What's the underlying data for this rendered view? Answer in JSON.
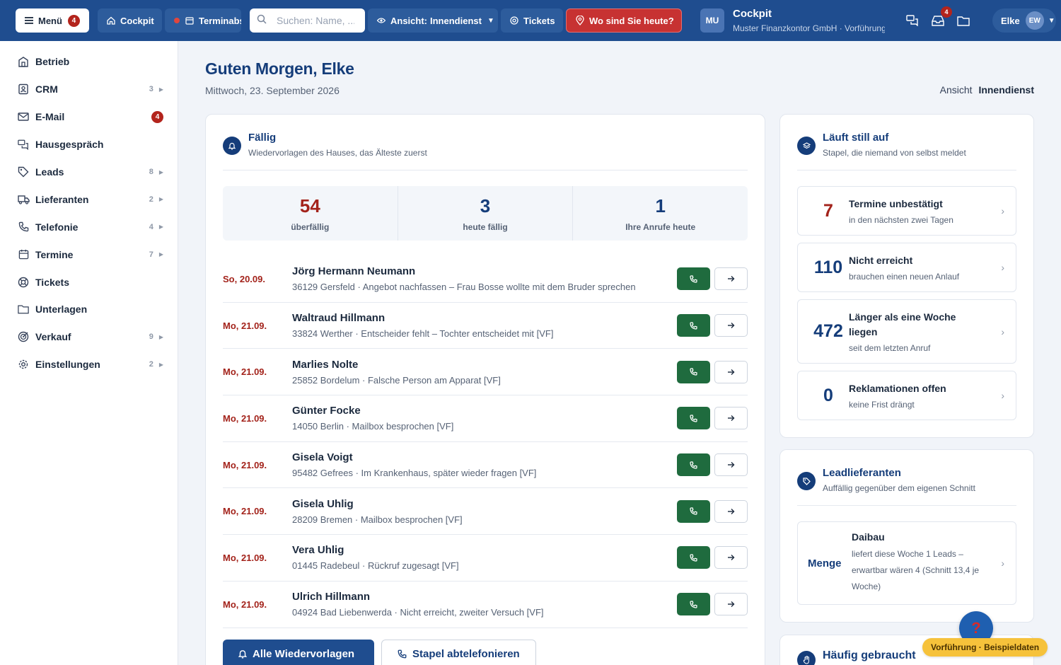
{
  "topbar": {
    "menu_label": "Menü",
    "menu_badge": "4",
    "cockpit_label": "Cockpit",
    "termin_label": "Terminabsprache",
    "search_placeholder": "Suchen: Name, ...",
    "ansicht_prefix": "Ansicht:",
    "ansicht_value": "Innendienst",
    "tickets_label": "Tickets",
    "wo_label": "Wo sind Sie heute?",
    "org_initials": "MU",
    "app_title": "Cockpit",
    "app_subtitle": "Muster Finanzkontor GmbH · Vorführung",
    "inbox_badge": "4",
    "user_name": "Elke",
    "user_initials": "EW"
  },
  "sidebar": {
    "items": [
      {
        "label": "Betrieb",
        "icon": "building-icon",
        "count": ""
      },
      {
        "label": "CRM",
        "icon": "contacts-icon",
        "count": "3"
      },
      {
        "label": "E-Mail",
        "icon": "mail-icon",
        "badge": "4"
      },
      {
        "label": "Hausgespräch",
        "icon": "chat-icon",
        "count": ""
      },
      {
        "label": "Leads",
        "icon": "tag-icon",
        "count": "8"
      },
      {
        "label": "Lieferanten",
        "icon": "truck-icon",
        "count": "2"
      },
      {
        "label": "Telefonie",
        "icon": "phone-icon",
        "count": "4"
      },
      {
        "label": "Termine",
        "icon": "calendar-icon",
        "count": "7"
      },
      {
        "label": "Tickets",
        "icon": "lifebuoy-icon",
        "count": ""
      },
      {
        "label": "Unterlagen",
        "icon": "folder-icon",
        "count": ""
      },
      {
        "label": "Verkauf",
        "icon": "target-icon",
        "count": "9"
      },
      {
        "label": "Einstellungen",
        "icon": "gear-icon",
        "count": "2"
      }
    ]
  },
  "main": {
    "greeting": "Guten Morgen, Elke",
    "date": "Mittwoch, 23. September 2026",
    "view_prefix": "Ansicht",
    "view_value": "Innendienst"
  },
  "due": {
    "title": "Fällig",
    "subtitle": "Wiedervorlagen des Hauses, das Älteste zuerst",
    "stats": [
      {
        "value": "54",
        "label": "überfällig"
      },
      {
        "value": "3",
        "label": "heute fällig"
      },
      {
        "value": "1",
        "label": "Ihre Anrufe heute"
      }
    ],
    "rows": [
      {
        "date": "So, 20.09.",
        "name": "Jörg Hermann Neumann",
        "detail": "36129 Gersfeld · Angebot nachfassen – Frau Bosse wollte mit dem Bruder sprechen"
      },
      {
        "date": "Mo, 21.09.",
        "name": "Waltraud Hillmann",
        "detail": "33824 Werther · Entscheider fehlt – Tochter entscheidet mit [VF]"
      },
      {
        "date": "Mo, 21.09.",
        "name": "Marlies Nolte",
        "detail": "25852 Bordelum · Falsche Person am Apparat [VF]"
      },
      {
        "date": "Mo, 21.09.",
        "name": "Günter Focke",
        "detail": "14050 Berlin · Mailbox besprochen [VF]"
      },
      {
        "date": "Mo, 21.09.",
        "name": "Gisela Voigt",
        "detail": "95482 Gefrees · Im Krankenhaus, später wieder fragen [VF]"
      },
      {
        "date": "Mo, 21.09.",
        "name": "Gisela Uhlig",
        "detail": "28209 Bremen · Mailbox besprochen [VF]"
      },
      {
        "date": "Mo, 21.09.",
        "name": "Vera Uhlig",
        "detail": "01445 Radebeul · Rückruf zugesagt [VF]"
      },
      {
        "date": "Mo, 21.09.",
        "name": "Ulrich Hillmann",
        "detail": "04924 Bad Liebenwerda · Nicht erreicht, zweiter Versuch [VF]"
      }
    ],
    "btn_all": "Alle Wiedervorlagen",
    "btn_batch": "Stapel abtelefonieren"
  },
  "idle": {
    "title": "Läuft still auf",
    "subtitle": "Stapel, die niemand von selbst meldet",
    "items": [
      {
        "value": "7",
        "title": "Termine unbestätigt",
        "sub": "in den nächsten zwei Tagen"
      },
      {
        "value": "110",
        "title": "Nicht erreicht",
        "sub": "brauchen einen neuen Anlauf"
      },
      {
        "value": "472",
        "title": "Länger als eine Woche liegen",
        "sub": "seit dem letzten Anruf"
      },
      {
        "value": "0",
        "title": "Reklamationen offen",
        "sub": "keine Frist drängt"
      }
    ]
  },
  "lead": {
    "title": "Leadlieferanten",
    "subtitle": "Auffällig gegenüber dem eigenen Schnitt",
    "item": {
      "key": "Menge",
      "title": "Daibau",
      "sub": "liefert diese Woche 1 Leads – erwartbar wären 4 (Schnitt 13,4 je Woche)"
    }
  },
  "freq": {
    "title": "Häufig gebraucht"
  },
  "help": {
    "glyph": "?"
  },
  "demo_tag": "Vorführung · Beispieldaten",
  "colors": {
    "accent": "#1f4d8f",
    "overdue": "#a3231b",
    "call": "#1f6b3e",
    "alert": "#c73232",
    "demo": "#f6c23b"
  }
}
